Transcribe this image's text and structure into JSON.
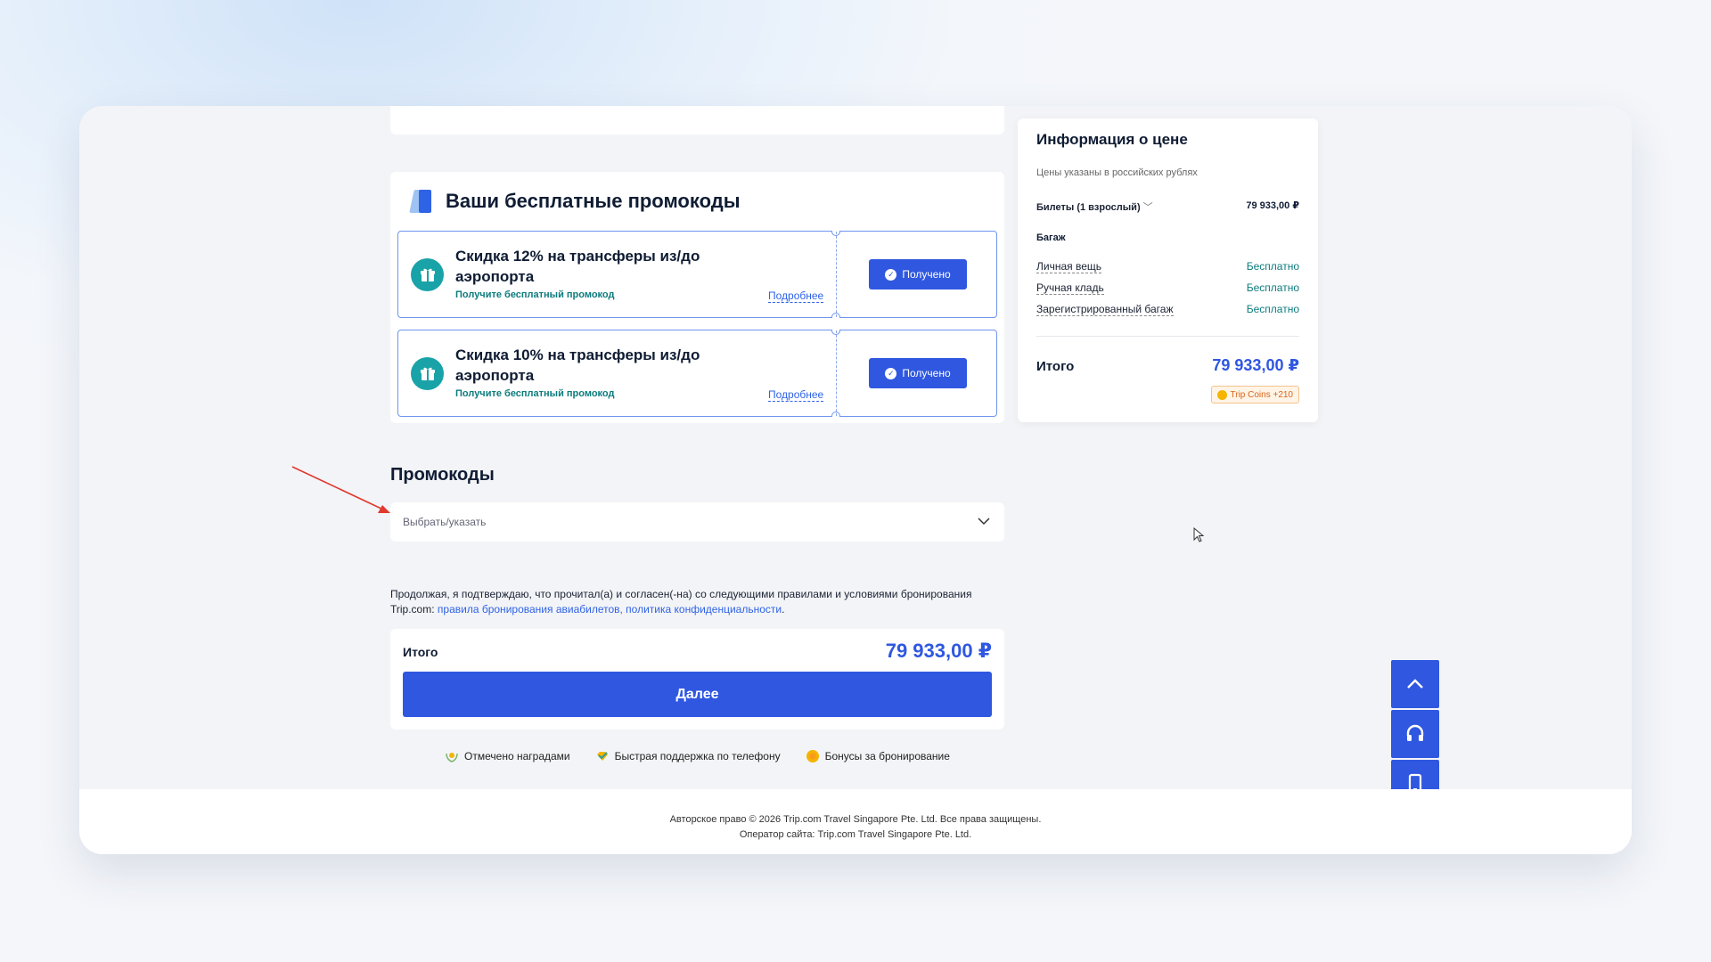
{
  "promo_section": {
    "title": "Ваши бесплатные промокоды",
    "coupons": [
      {
        "title": "Скидка 12% на трансферы из/до аэропорта",
        "subtitle": "Получите бесплатный промокод",
        "more": "Подробнее",
        "status": "Получено"
      },
      {
        "title": "Скидка 10% на трансферы из/до аэропорта",
        "subtitle": "Получите бесплатный промокод",
        "more": "Подробнее",
        "status": "Получено"
      }
    ]
  },
  "promocodes": {
    "title": "Промокоды",
    "select_placeholder": "Выбрать/указать"
  },
  "terms": {
    "text": "Продолжая, я подтверждаю, что прочитал(а) и согласен(-на) со следующими правилами и условиями бронирования Trip.com: ",
    "links": "правила бронирования авиабилетов, политика конфиденциальности",
    "end": "."
  },
  "total": {
    "label": "Итого",
    "value": "79 933,00 ₽",
    "next_button": "Далее"
  },
  "badges": [
    {
      "icon": "award-icon",
      "label": "Отмечено наградами"
    },
    {
      "icon": "check-heart-icon",
      "label": "Быстрая поддержка по телефону"
    },
    {
      "icon": "bonus-coin-icon",
      "label": "Бонусы за бронирование"
    }
  ],
  "price_info": {
    "title": "Информация о цене",
    "note": "Цены указаны в российских рублях",
    "tickets_label": "Билеты (1 взрослый)",
    "tickets_value": "79 933,00 ₽",
    "baggage_title": "Багаж",
    "baggage": [
      {
        "label": "Личная вещь",
        "value": "Бесплатно"
      },
      {
        "label": "Ручная кладь",
        "value": "Бесплатно"
      },
      {
        "label": "Зарегистрированный багаж",
        "value": "Бесплатно"
      }
    ],
    "total_label": "Итого",
    "total_value": "79 933,00 ₽",
    "coins": "Trip Coins +210"
  },
  "footer": {
    "copyright": "Авторское право © 2026 Trip.com Travel Singapore Pte. Ltd. Все права защищены.",
    "operator": "Оператор сайта: Trip.com Travel Singapore Pte. Ltd."
  },
  "colors": {
    "accent": "#2f57e0",
    "teal": "#0c7c7e",
    "annotation_arrow": "#e0392e"
  }
}
